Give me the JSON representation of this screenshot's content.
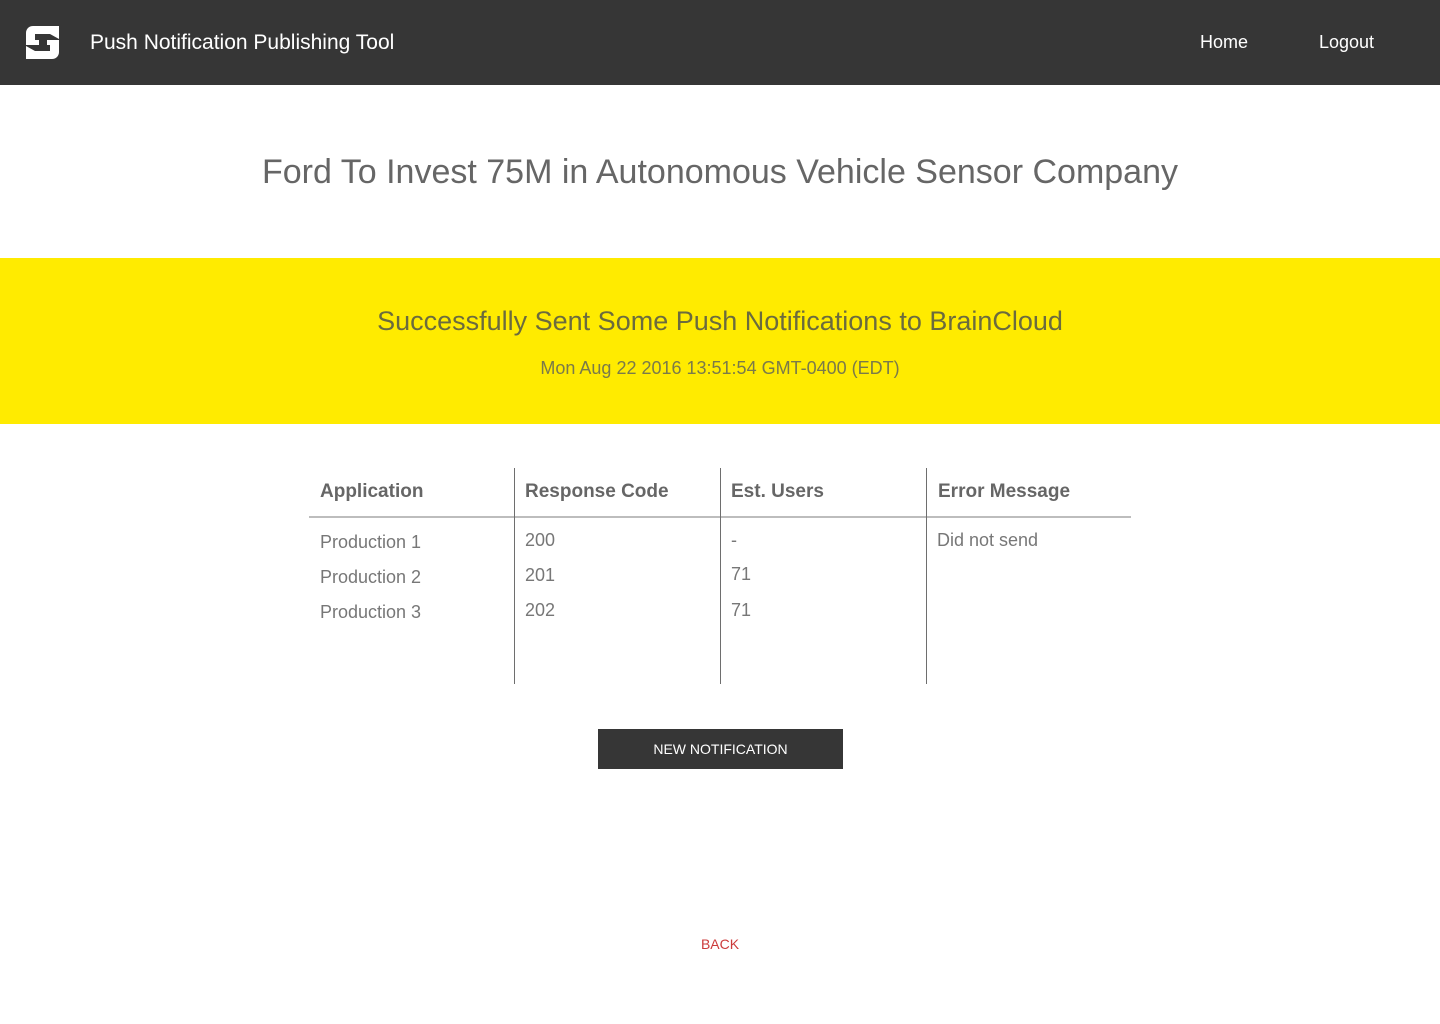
{
  "header": {
    "logo_icon": "brand-s-logo-icon",
    "title": "Push Notification Publishing Tool",
    "nav": {
      "home_label": "Home",
      "logout_label": "Logout"
    }
  },
  "article": {
    "title": "Ford To Invest 75M in Autonomous Vehicle Sensor Company"
  },
  "banner": {
    "title": "Successfully Sent Some Push Notifications to BrainCloud",
    "timestamp": "Mon Aug 22 2016 13:51:54 GMT-0400 (EDT)",
    "color": "#ffeb00"
  },
  "results": {
    "headers": {
      "application": "Application",
      "response_code": "Response Code",
      "est_users": "Est. Users",
      "error_message": "Error Message"
    },
    "rows": [
      {
        "application": "Production 1",
        "response_code": "200",
        "est_users": "-",
        "error_message": "Did not send"
      },
      {
        "application": "Production 2",
        "response_code": "201",
        "est_users": "71",
        "error_message": ""
      },
      {
        "application": "Production 3",
        "response_code": "202",
        "est_users": "71",
        "error_message": ""
      }
    ]
  },
  "actions": {
    "new_notification_label": "NEW NOTIFICATION",
    "back_label": "BACK"
  },
  "colors": {
    "topbar": "#363636",
    "back_link": "#cc3b3b"
  }
}
